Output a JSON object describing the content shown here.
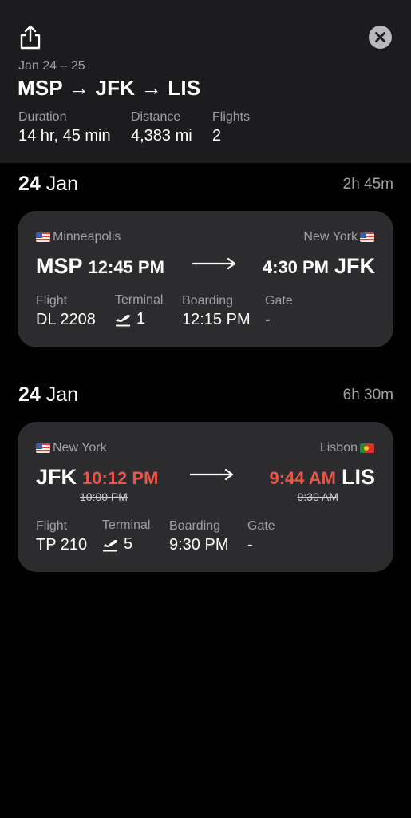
{
  "header": {
    "share_icon": "share-icon",
    "close_icon": "close-icon",
    "dates": "Jan 24 – 25",
    "route": "MSP → JFK → LIS",
    "stats": [
      {
        "label": "Duration",
        "value": "14 hr, 45 min"
      },
      {
        "label": "Distance",
        "value": "4,383 mi"
      },
      {
        "label": "Flights",
        "value": "2"
      }
    ]
  },
  "legs": [
    {
      "day_num": "24",
      "day_month": "Jan",
      "duration": "2h 45m",
      "origin_city": "Minneapolis",
      "origin_flag": "flag-us-icon",
      "dest_city": "New York",
      "dest_flag": "flag-us-icon",
      "origin_code": "MSP",
      "dep_time": "12:45 PM",
      "arr_time": "4:30 PM",
      "dest_code": "JFK",
      "labels": {
        "flight": "Flight",
        "terminal": "Terminal",
        "boarding": "Boarding",
        "gate": "Gate"
      },
      "flight": "DL 2208",
      "terminal": "1",
      "boarding": "12:15 PM",
      "gate": "-"
    },
    {
      "day_num": "24",
      "day_month": "Jan",
      "duration": "6h 30m",
      "origin_city": "New York",
      "origin_flag": "flag-us-icon",
      "dest_city": "Lisbon",
      "dest_flag": "flag-pt-icon",
      "origin_code": "JFK",
      "dep_time": "10:12 PM",
      "dep_time_original": "10:00 PM",
      "arr_time": "9:44 AM",
      "arr_time_original": "9:30 AM",
      "dest_code": "LIS",
      "delay_color": "#e8564a",
      "labels": {
        "flight": "Flight",
        "terminal": "Terminal",
        "boarding": "Boarding",
        "gate": "Gate"
      },
      "flight": "TP 210",
      "terminal": "5",
      "boarding": "9:30 PM",
      "gate": "-"
    }
  ]
}
